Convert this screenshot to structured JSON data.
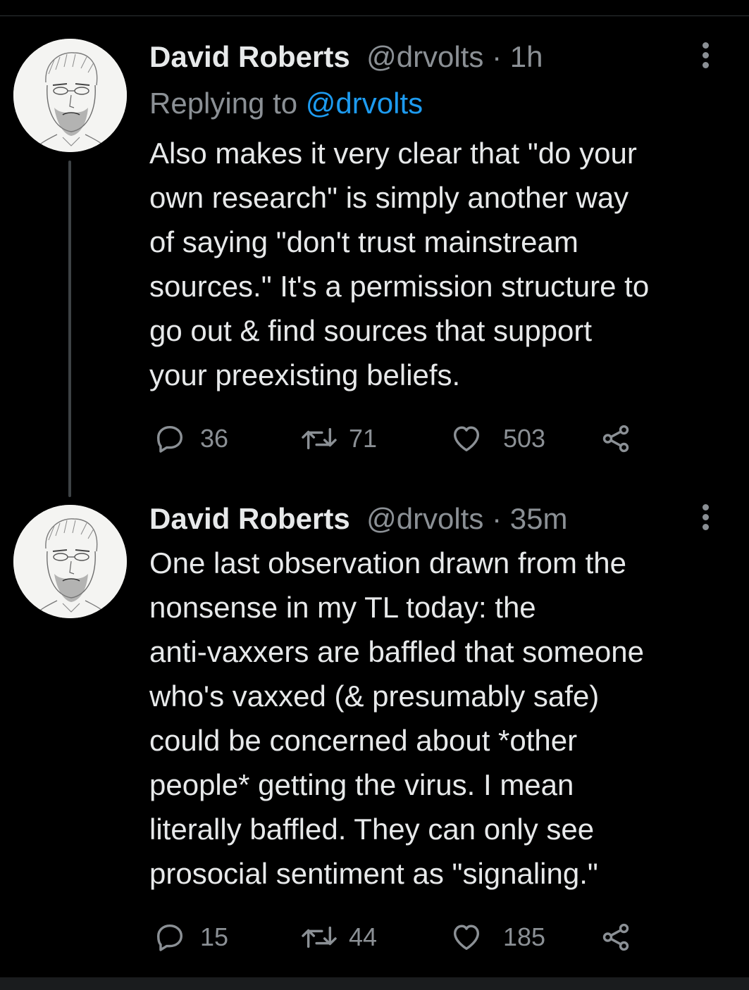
{
  "tweets": [
    {
      "name": "David Roberts",
      "handle": "@drvolts",
      "time": "1h",
      "replying_prefix": "Replying to ",
      "replying_to": "@drvolts",
      "text_lines": [
        "Also makes it very clear that \"do your",
        "own research\" is simply another way",
        "of saying \"don't trust mainstream",
        "sources.\" It's a permission structure to",
        "go out & find sources that support",
        "your preexisting beliefs."
      ],
      "replies": "36",
      "retweets": "71",
      "likes": "503"
    },
    {
      "name": "David Roberts",
      "handle": "@drvolts",
      "time": "35m",
      "text_lines": [
        "One last observation drawn from the",
        "nonsense in my TL today: the",
        "anti-vaxxers are baffled that someone",
        "who's vaxxed (& presumably safe)",
        "could be concerned about *other",
        "people* getting the virus. I mean",
        "literally baffled. They can only see",
        "prosocial sentiment as \"signaling.\""
      ],
      "replies": "15",
      "retweets": "44",
      "likes": "185"
    }
  ],
  "separator": " · ",
  "icons": {
    "reply": "reply-icon",
    "retweet": "retweet-icon",
    "like": "heart-icon",
    "share": "share-icon",
    "more": "more-vertical-icon",
    "avatar": "sketch-portrait-avatar"
  },
  "colors": {
    "background": "#000000",
    "text": "#e7e9ea",
    "secondary": "#8b9095",
    "link": "#1d9bf0",
    "thread_line": "#3d4245"
  }
}
